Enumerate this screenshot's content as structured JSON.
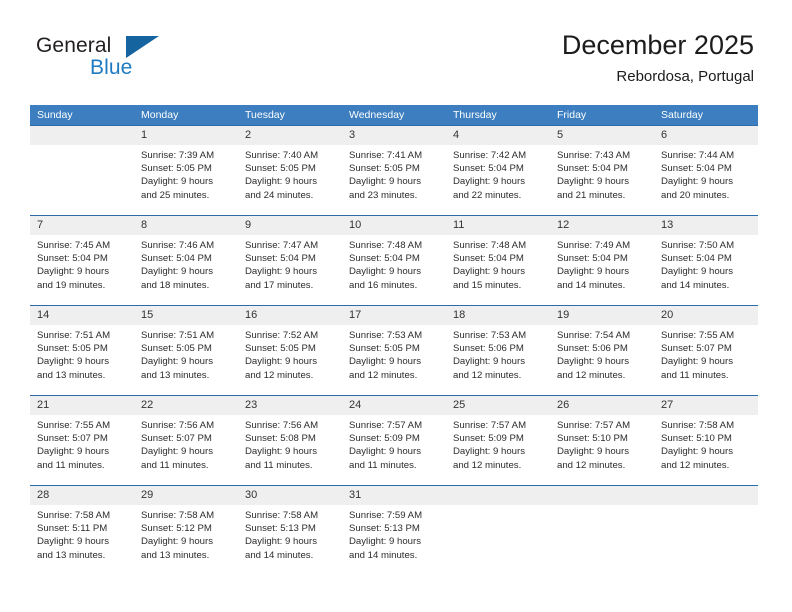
{
  "brand": {
    "name_part1": "General",
    "name_part2": "Blue",
    "logo_icon": "triangle-flag-icon"
  },
  "header": {
    "title": "December 2025",
    "subtitle": "Rebordosa, Portugal"
  },
  "colors": {
    "header_blue": "#3c7ebf",
    "divider_blue": "#2b6ca8",
    "daynum_band": "#efefef",
    "brand_blue": "#1f7bc1",
    "logo_blue": "#15639f"
  },
  "weekdays": [
    "Sunday",
    "Monday",
    "Tuesday",
    "Wednesday",
    "Thursday",
    "Friday",
    "Saturday"
  ],
  "weeks": [
    [
      {
        "day": "",
        "sunrise": "",
        "sunset": "",
        "daylight_1": "",
        "daylight_2": ""
      },
      {
        "day": "1",
        "sunrise": "Sunrise: 7:39 AM",
        "sunset": "Sunset: 5:05 PM",
        "daylight_1": "Daylight: 9 hours",
        "daylight_2": "and 25 minutes."
      },
      {
        "day": "2",
        "sunrise": "Sunrise: 7:40 AM",
        "sunset": "Sunset: 5:05 PM",
        "daylight_1": "Daylight: 9 hours",
        "daylight_2": "and 24 minutes."
      },
      {
        "day": "3",
        "sunrise": "Sunrise: 7:41 AM",
        "sunset": "Sunset: 5:05 PM",
        "daylight_1": "Daylight: 9 hours",
        "daylight_2": "and 23 minutes."
      },
      {
        "day": "4",
        "sunrise": "Sunrise: 7:42 AM",
        "sunset": "Sunset: 5:04 PM",
        "daylight_1": "Daylight: 9 hours",
        "daylight_2": "and 22 minutes."
      },
      {
        "day": "5",
        "sunrise": "Sunrise: 7:43 AM",
        "sunset": "Sunset: 5:04 PM",
        "daylight_1": "Daylight: 9 hours",
        "daylight_2": "and 21 minutes."
      },
      {
        "day": "6",
        "sunrise": "Sunrise: 7:44 AM",
        "sunset": "Sunset: 5:04 PM",
        "daylight_1": "Daylight: 9 hours",
        "daylight_2": "and 20 minutes."
      }
    ],
    [
      {
        "day": "7",
        "sunrise": "Sunrise: 7:45 AM",
        "sunset": "Sunset: 5:04 PM",
        "daylight_1": "Daylight: 9 hours",
        "daylight_2": "and 19 minutes."
      },
      {
        "day": "8",
        "sunrise": "Sunrise: 7:46 AM",
        "sunset": "Sunset: 5:04 PM",
        "daylight_1": "Daylight: 9 hours",
        "daylight_2": "and 18 minutes."
      },
      {
        "day": "9",
        "sunrise": "Sunrise: 7:47 AM",
        "sunset": "Sunset: 5:04 PM",
        "daylight_1": "Daylight: 9 hours",
        "daylight_2": "and 17 minutes."
      },
      {
        "day": "10",
        "sunrise": "Sunrise: 7:48 AM",
        "sunset": "Sunset: 5:04 PM",
        "daylight_1": "Daylight: 9 hours",
        "daylight_2": "and 16 minutes."
      },
      {
        "day": "11",
        "sunrise": "Sunrise: 7:48 AM",
        "sunset": "Sunset: 5:04 PM",
        "daylight_1": "Daylight: 9 hours",
        "daylight_2": "and 15 minutes."
      },
      {
        "day": "12",
        "sunrise": "Sunrise: 7:49 AM",
        "sunset": "Sunset: 5:04 PM",
        "daylight_1": "Daylight: 9 hours",
        "daylight_2": "and 14 minutes."
      },
      {
        "day": "13",
        "sunrise": "Sunrise: 7:50 AM",
        "sunset": "Sunset: 5:04 PM",
        "daylight_1": "Daylight: 9 hours",
        "daylight_2": "and 14 minutes."
      }
    ],
    [
      {
        "day": "14",
        "sunrise": "Sunrise: 7:51 AM",
        "sunset": "Sunset: 5:05 PM",
        "daylight_1": "Daylight: 9 hours",
        "daylight_2": "and 13 minutes."
      },
      {
        "day": "15",
        "sunrise": "Sunrise: 7:51 AM",
        "sunset": "Sunset: 5:05 PM",
        "daylight_1": "Daylight: 9 hours",
        "daylight_2": "and 13 minutes."
      },
      {
        "day": "16",
        "sunrise": "Sunrise: 7:52 AM",
        "sunset": "Sunset: 5:05 PM",
        "daylight_1": "Daylight: 9 hours",
        "daylight_2": "and 12 minutes."
      },
      {
        "day": "17",
        "sunrise": "Sunrise: 7:53 AM",
        "sunset": "Sunset: 5:05 PM",
        "daylight_1": "Daylight: 9 hours",
        "daylight_2": "and 12 minutes."
      },
      {
        "day": "18",
        "sunrise": "Sunrise: 7:53 AM",
        "sunset": "Sunset: 5:06 PM",
        "daylight_1": "Daylight: 9 hours",
        "daylight_2": "and 12 minutes."
      },
      {
        "day": "19",
        "sunrise": "Sunrise: 7:54 AM",
        "sunset": "Sunset: 5:06 PM",
        "daylight_1": "Daylight: 9 hours",
        "daylight_2": "and 12 minutes."
      },
      {
        "day": "20",
        "sunrise": "Sunrise: 7:55 AM",
        "sunset": "Sunset: 5:07 PM",
        "daylight_1": "Daylight: 9 hours",
        "daylight_2": "and 11 minutes."
      }
    ],
    [
      {
        "day": "21",
        "sunrise": "Sunrise: 7:55 AM",
        "sunset": "Sunset: 5:07 PM",
        "daylight_1": "Daylight: 9 hours",
        "daylight_2": "and 11 minutes."
      },
      {
        "day": "22",
        "sunrise": "Sunrise: 7:56 AM",
        "sunset": "Sunset: 5:07 PM",
        "daylight_1": "Daylight: 9 hours",
        "daylight_2": "and 11 minutes."
      },
      {
        "day": "23",
        "sunrise": "Sunrise: 7:56 AM",
        "sunset": "Sunset: 5:08 PM",
        "daylight_1": "Daylight: 9 hours",
        "daylight_2": "and 11 minutes."
      },
      {
        "day": "24",
        "sunrise": "Sunrise: 7:57 AM",
        "sunset": "Sunset: 5:09 PM",
        "daylight_1": "Daylight: 9 hours",
        "daylight_2": "and 11 minutes."
      },
      {
        "day": "25",
        "sunrise": "Sunrise: 7:57 AM",
        "sunset": "Sunset: 5:09 PM",
        "daylight_1": "Daylight: 9 hours",
        "daylight_2": "and 12 minutes."
      },
      {
        "day": "26",
        "sunrise": "Sunrise: 7:57 AM",
        "sunset": "Sunset: 5:10 PM",
        "daylight_1": "Daylight: 9 hours",
        "daylight_2": "and 12 minutes."
      },
      {
        "day": "27",
        "sunrise": "Sunrise: 7:58 AM",
        "sunset": "Sunset: 5:10 PM",
        "daylight_1": "Daylight: 9 hours",
        "daylight_2": "and 12 minutes."
      }
    ],
    [
      {
        "day": "28",
        "sunrise": "Sunrise: 7:58 AM",
        "sunset": "Sunset: 5:11 PM",
        "daylight_1": "Daylight: 9 hours",
        "daylight_2": "and 13 minutes."
      },
      {
        "day": "29",
        "sunrise": "Sunrise: 7:58 AM",
        "sunset": "Sunset: 5:12 PM",
        "daylight_1": "Daylight: 9 hours",
        "daylight_2": "and 13 minutes."
      },
      {
        "day": "30",
        "sunrise": "Sunrise: 7:58 AM",
        "sunset": "Sunset: 5:13 PM",
        "daylight_1": "Daylight: 9 hours",
        "daylight_2": "and 14 minutes."
      },
      {
        "day": "31",
        "sunrise": "Sunrise: 7:59 AM",
        "sunset": "Sunset: 5:13 PM",
        "daylight_1": "Daylight: 9 hours",
        "daylight_2": "and 14 minutes."
      },
      {
        "day": "",
        "sunrise": "",
        "sunset": "",
        "daylight_1": "",
        "daylight_2": ""
      },
      {
        "day": "",
        "sunrise": "",
        "sunset": "",
        "daylight_1": "",
        "daylight_2": ""
      },
      {
        "day": "",
        "sunrise": "",
        "sunset": "",
        "daylight_1": "",
        "daylight_2": ""
      }
    ]
  ]
}
